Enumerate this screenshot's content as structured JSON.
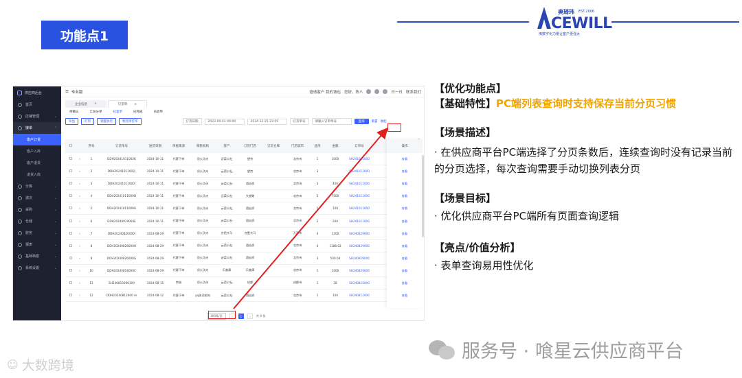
{
  "slide": {
    "title": "功能点1",
    "brand_cn": "奥琦玮",
    "brand_est": "EST.2006",
    "brand_name": "CEWILL",
    "brand_tag": "用数字化力量让客户更强大"
  },
  "app": {
    "logo_text": "供应商后台",
    "topbar_title": "专业版",
    "topbar_right": [
      "邀请客户 我的钱包",
      "您好，陈八",
      "日一日",
      "联系我们"
    ],
    "sidebar": [
      {
        "label": "首页",
        "has_children": false
      },
      {
        "label": "店铺管理",
        "has_children": true
      },
      {
        "label": "接单",
        "has_children": true,
        "active": true
      },
      {
        "label": "分拣",
        "has_children": true
      },
      {
        "label": "波次",
        "has_children": true
      },
      {
        "label": "采购",
        "has_children": true
      },
      {
        "label": "仓储",
        "has_children": true
      },
      {
        "label": "财务",
        "has_children": true
      },
      {
        "label": "报表",
        "has_children": true
      },
      {
        "label": "基础档案",
        "has_children": true
      },
      {
        "label": "系统设置",
        "has_children": true
      }
    ],
    "sidebar_sub": [
      "客户订货",
      "客户入库",
      "客户退货",
      "退货入库"
    ],
    "tabs": [
      "企业信息",
      "订货单"
    ],
    "subtabs": [
      "待确认",
      "汇总分单",
      "已复单",
      "已完成",
      "已退单"
    ],
    "toolbar_buttons": [
      "导出",
      "打印",
      "调度执行",
      "物流单打印"
    ],
    "filters": {
      "date_type": "订货日期",
      "start": "2023-09-01 00:00",
      "end": "2024-12-25 23:59",
      "order_no": "订货单号",
      "customer_placeholder": "请输入订单单号"
    },
    "search_label": "查询",
    "reset_label": "重置",
    "collapse_label": "收起",
    "columns": [
      "序号",
      "订货单号",
      "送货日期",
      "单据来源",
      "销售机构",
      "客户",
      "订货门店",
      "订货仓库",
      "门店城市",
      "品项",
      "金额",
      "订单号"
    ],
    "operation_header": "操作",
    "operation_label": "查看",
    "rows": [
      [
        "1",
        "DDH20241011002K",
        "2024-10-11",
        "代客下单",
        "须火功夫",
        "云菜公社",
        "望京",
        "",
        "北京市",
        "1",
        "1000",
        "SH241011000"
      ],
      [
        "2",
        "DDH20241011002J",
        "2024-10-11",
        "代客下单",
        "须火功夫",
        "云菜公社",
        "望京",
        "",
        "北京市",
        "3",
        "",
        "SH241011000"
      ],
      [
        "3",
        "DDH20241011000I",
        "2024-10-11",
        "代客下单",
        "须火功夫",
        "云菜公社",
        "酒仙桥",
        "",
        "北京市",
        "3",
        "400",
        "SH241011000"
      ],
      [
        "4",
        "DDH20241011000H",
        "2024-10-11",
        "代客下单",
        "须火功夫",
        "云菜公社",
        "大望路",
        "",
        "北京市",
        "5",
        "7500",
        "SH241011000"
      ],
      [
        "5",
        "DDH20241011000G",
        "2024-10-11",
        "代客下单",
        "须火功夫",
        "云菜公社",
        "酒仙桥",
        "",
        "北京市",
        "1",
        "100",
        "SH241011000"
      ],
      [
        "6",
        "DDH20240919000E",
        "2024-10-11",
        "代客下单",
        "须火功夫",
        "云菜公社",
        "酒仙桥",
        "",
        "北京市",
        "2",
        "200",
        "SH241011000"
      ],
      [
        "7",
        "DDH20240826000I",
        "2024-08-29",
        "代客下单",
        "须火功夫",
        "合肥大马",
        "合肥大马",
        "",
        "天津市",
        "4",
        "1200",
        "SH240829000"
      ],
      [
        "8",
        "DDH20240826000H",
        "2024-08-29",
        "代客下单",
        "须火功夫",
        "云菜公社",
        "酒仙桥",
        "",
        "北京市",
        "4",
        "1186.02",
        "SH240829000"
      ],
      [
        "9",
        "DDH20240826000G",
        "2024-08-29",
        "代客下单",
        "须火功夫",
        "云菜公社",
        "酒仙桥",
        "",
        "北京市",
        "3",
        "500.04",
        "SH240829000"
      ],
      [
        "10",
        "DDH20240816000C",
        "2024-08-29",
        "代客下单",
        "须火功夫",
        "乐美康",
        "乐美康",
        "",
        "北京市",
        "1",
        "1000",
        "SH240829000"
      ],
      [
        "11",
        "SH240815000109",
        "2024-08-15",
        "商城",
        "须火功夫",
        "云菜公社",
        "成都",
        "",
        "成都市",
        "1",
        "28",
        "SH240815000"
      ],
      [
        "12",
        "DDH20240812000 m",
        "2024-08-12",
        "代客下单",
        "yq测试机构",
        "云菜公社",
        "酒仙桥",
        "",
        "北京市",
        "1",
        "100",
        "SH240812000"
      ]
    ],
    "pager": {
      "page_size": "300条/页",
      "current_page": "1",
      "total": "共 8 条"
    }
  },
  "panel": {
    "h1": "【优化功能点】",
    "h2_label": "【基础特性】",
    "h2_value": "PC端列表查询时支持保存当前分页习惯",
    "h3": "【场景描述】",
    "p3": "· 在供应商平台PC端选择了分页条数后，连续查询时没有记录当前的分页选择，每次查询需要手动切换列表分页",
    "h4": "【场景目标】",
    "p4": "· 优化供应商平台PC端所有页面查询逻辑",
    "h5": "【亮点/价值分析】",
    "p5": "· 表单查询易用性优化"
  },
  "watermark": {
    "main": "服务号 · 喰星云供应商平台",
    "corner": "大数跨境"
  },
  "colors": {
    "accent": "#2a52e0",
    "highlight": "#f0a400",
    "annotation": "#e02020"
  }
}
